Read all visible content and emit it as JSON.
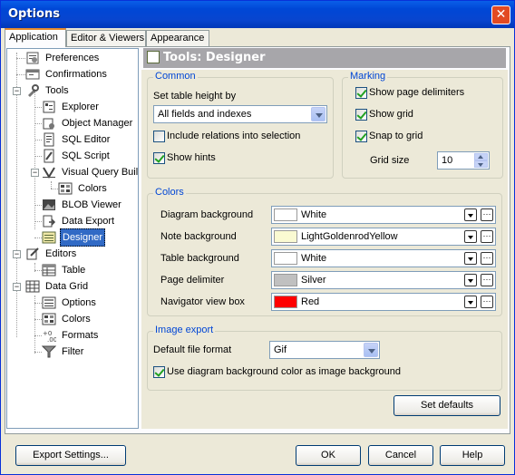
{
  "window": {
    "title": "Options"
  },
  "tabs": [
    {
      "label": "Application"
    },
    {
      "label": "Editor & Viewers"
    },
    {
      "label": "Appearance"
    }
  ],
  "tree": {
    "items": [
      {
        "label": "Preferences",
        "icon": "preferences-icon"
      },
      {
        "label": "Confirmations",
        "icon": "confirmations-icon"
      },
      {
        "label": "Tools",
        "icon": "tools-icon"
      },
      {
        "label": "Explorer",
        "icon": "explorer-icon"
      },
      {
        "label": "Object Manager",
        "icon": "object-manager-icon"
      },
      {
        "label": "SQL Editor",
        "icon": "sql-editor-icon"
      },
      {
        "label": "SQL Script",
        "icon": "sql-script-icon"
      },
      {
        "label": "Visual Query Builder",
        "icon": "visual-query-builder-icon"
      },
      {
        "label": "Colors",
        "icon": "colors-icon"
      },
      {
        "label": "BLOB Viewer",
        "icon": "blob-viewer-icon"
      },
      {
        "label": "Data Export",
        "icon": "data-export-icon"
      },
      {
        "label": "Designer",
        "icon": "designer-icon"
      },
      {
        "label": "Editors",
        "icon": "editors-icon"
      },
      {
        "label": "Table",
        "icon": "table-icon"
      },
      {
        "label": "Data Grid",
        "icon": "data-grid-icon"
      },
      {
        "label": "Options",
        "icon": "options-icon"
      },
      {
        "label": "Colors",
        "icon": "colors-icon"
      },
      {
        "label": "Formats",
        "icon": "formats-icon"
      },
      {
        "label": "Filter",
        "icon": "filter-icon"
      }
    ]
  },
  "header": {
    "title": "Tools: Designer"
  },
  "common": {
    "group_label": "Common",
    "table_height_label": "Set table height by",
    "table_height_value": "All fields and indexes",
    "include_relations": {
      "label": "Include relations into selection",
      "checked": false
    },
    "show_hints": {
      "label": "Show hints",
      "checked": true
    }
  },
  "marking": {
    "group_label": "Marking",
    "show_page_delimiters": {
      "label": "Show page delimiters",
      "checked": true
    },
    "show_grid": {
      "label": "Show grid",
      "checked": true
    },
    "snap_to_grid": {
      "label": "Snap to grid",
      "checked": true
    },
    "grid_size_label": "Grid size",
    "grid_size_value": "10"
  },
  "colors": {
    "group_label": "Colors",
    "rows": [
      {
        "label": "Diagram background",
        "color_name": "White",
        "swatch": "#ffffff"
      },
      {
        "label": "Note background",
        "color_name": "LightGoldenrodYellow",
        "swatch": "#fafad2"
      },
      {
        "label": "Table background",
        "color_name": "White",
        "swatch": "#ffffff"
      },
      {
        "label": "Page delimiter",
        "color_name": "Silver",
        "swatch": "#c0c0c0"
      },
      {
        "label": "Navigator view box",
        "color_name": "Red",
        "swatch": "#ff0000"
      }
    ]
  },
  "image_export": {
    "group_label": "Image export",
    "format_label": "Default file format",
    "format_value": "Gif",
    "use_bg": {
      "label": "Use diagram background color as image background",
      "checked": true
    }
  },
  "buttons": {
    "set_defaults": "Set defaults",
    "export_settings": "Export Settings...",
    "ok": "OK",
    "cancel": "Cancel",
    "help": "Help"
  }
}
